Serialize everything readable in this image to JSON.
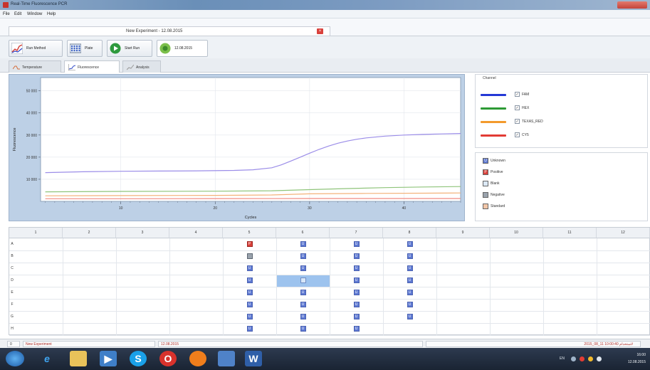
{
  "window": {
    "title": "Real-Time Fluorescence PCR"
  },
  "menu": {
    "items": [
      "File",
      "Edit",
      "Window",
      "Help"
    ]
  },
  "document_tab": {
    "label": "New Experiment - 12.08.2015"
  },
  "toolbar": {
    "buttons": [
      {
        "label": "Run Method",
        "icon": "chart-line-icon"
      },
      {
        "label": "Plate",
        "icon": "plate-icon"
      },
      {
        "label": "Start Run",
        "icon": "play-icon"
      },
      {
        "label": "12.08.2015",
        "icon": "run-status-icon"
      }
    ]
  },
  "subtabs": [
    {
      "label": "Temperature",
      "active": false
    },
    {
      "label": "Fluorescence",
      "active": true
    },
    {
      "label": "Analysis",
      "active": false
    }
  ],
  "chart_data": {
    "type": "line",
    "title": "",
    "xlabel": "Cycles",
    "ylabel": "Fluorescence",
    "xlim": [
      1.5,
      46
    ],
    "ylim": [
      0,
      56000
    ],
    "x_ticks": [
      "10",
      "20",
      "30",
      "40"
    ],
    "y_ticks": [
      "10 000",
      "20 000",
      "30 000",
      "40 000",
      "50 000"
    ],
    "grid": true,
    "series": [
      {
        "name": "FAM",
        "color": "#9b8de8",
        "x": [
          2,
          6,
          10,
          14,
          18,
          22,
          24,
          26,
          27,
          28,
          29,
          30,
          31,
          32,
          33,
          34,
          35,
          36,
          38,
          40,
          42,
          44,
          46
        ],
        "y": [
          13000,
          13400,
          13600,
          13700,
          13800,
          14000,
          14300,
          15200,
          16500,
          18200,
          20000,
          21800,
          23500,
          25000,
          26300,
          27300,
          28100,
          28700,
          29500,
          30000,
          30300,
          30500,
          30700
        ]
      },
      {
        "name": "HEX",
        "color": "#8fc47a",
        "x": [
          2,
          10,
          20,
          26,
          30,
          34,
          38,
          42,
          46
        ],
        "y": [
          4300,
          4500,
          4600,
          4800,
          5300,
          5800,
          6200,
          6500,
          6700
        ]
      },
      {
        "name": "TEXAS_RED",
        "color": "#f4b27a",
        "x": [
          2,
          10,
          20,
          26,
          30,
          36,
          42,
          46
        ],
        "y": [
          2500,
          2600,
          2700,
          2900,
          3400,
          3600,
          3700,
          3800
        ]
      },
      {
        "name": "CY5",
        "color": "#f08a82",
        "x": [
          2,
          10,
          20,
          30,
          40,
          46
        ],
        "y": [
          1200,
          1200,
          1250,
          1300,
          1300,
          1300
        ]
      }
    ]
  },
  "channels": {
    "header": "Channel",
    "items": [
      {
        "label": "FAM",
        "color": "#2438d6",
        "checked": true
      },
      {
        "label": "HEX",
        "color": "#2d9a35",
        "checked": true
      },
      {
        "label": "TEXAS_RED",
        "color": "#f39a2c",
        "checked": true
      },
      {
        "label": "CY5",
        "color": "#e23b34",
        "checked": true
      }
    ]
  },
  "sample_legend": [
    {
      "label": "Unknown",
      "code": "U",
      "color": "#5d78d2"
    },
    {
      "label": "Positive",
      "code": "P",
      "color": "#d9403a"
    },
    {
      "label": "Blank",
      "code": "",
      "color": "#dbe8f6"
    },
    {
      "label": "Negative",
      "code": "",
      "color": "#9aa3ad"
    },
    {
      "label": "Standard",
      "code": "",
      "color": "#f2c6a8"
    }
  ],
  "plate": {
    "columns": [
      "1",
      "2",
      "3",
      "4",
      "5",
      "6",
      "7",
      "8",
      "9",
      "10",
      "11",
      "12"
    ],
    "rows": [
      "A",
      "B",
      "C",
      "D",
      "E",
      "F",
      "G",
      "H"
    ],
    "wells": {
      "A": [
        "",
        "",
        "",
        "",
        "P",
        "U",
        "U",
        "U",
        "",
        "",
        "",
        ""
      ],
      "B": [
        "",
        "",
        "",
        "",
        "N",
        "U",
        "U",
        "U",
        "",
        "",
        "",
        ""
      ],
      "C": [
        "",
        "",
        "",
        "",
        "U",
        "U",
        "U",
        "U",
        "",
        "",
        "",
        ""
      ],
      "D": [
        "",
        "",
        "",
        "",
        "U",
        "S",
        "U",
        "U",
        "",
        "",
        "",
        ""
      ],
      "E": [
        "",
        "",
        "",
        "",
        "U",
        "U",
        "U",
        "U",
        "",
        "",
        "",
        ""
      ],
      "F": [
        "",
        "",
        "",
        "",
        "U",
        "U",
        "U",
        "U",
        "",
        "",
        "",
        ""
      ],
      "G": [
        "",
        "",
        "",
        "",
        "U",
        "U",
        "U",
        "U",
        "",
        "",
        "",
        ""
      ],
      "H": [
        "",
        "",
        "",
        "",
        "U",
        "U",
        "U",
        "",
        "",
        "",
        "",
        ""
      ]
    }
  },
  "status": {
    "count": "0",
    "experiment": "New Experiment",
    "date": "12.08.2015",
    "right": "2015_08_11 10:00:40 لاستخدام"
  },
  "taskbar": {
    "language": "EN",
    "time": "16:00",
    "date": "12.08.2015"
  }
}
